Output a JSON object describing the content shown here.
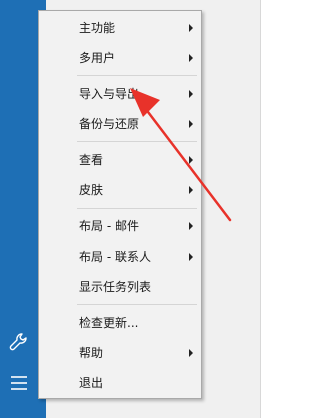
{
  "sidebar": {
    "icons": [
      "wrench-icon",
      "hamburger-menu-icon"
    ]
  },
  "menu": {
    "items": [
      {
        "label": "主功能",
        "has_submenu": true
      },
      {
        "label": "多用户",
        "has_submenu": true
      },
      {
        "label": "导入与导出",
        "has_submenu": true
      },
      {
        "label": "备份与还原",
        "has_submenu": true
      },
      {
        "label": "查看",
        "has_submenu": true
      },
      {
        "label": "皮肤",
        "has_submenu": true
      },
      {
        "label": "布局 - 邮件",
        "has_submenu": true
      },
      {
        "label": "布局 - 联系人",
        "has_submenu": true
      },
      {
        "label": "显示任务列表",
        "has_submenu": false
      },
      {
        "label": "检查更新...",
        "has_submenu": false
      },
      {
        "label": "帮助",
        "has_submenu": true
      },
      {
        "label": "退出",
        "has_submenu": false
      }
    ]
  },
  "colors": {
    "sidebar": "#1e6fb5",
    "annotation_arrow": "#e8322a"
  }
}
